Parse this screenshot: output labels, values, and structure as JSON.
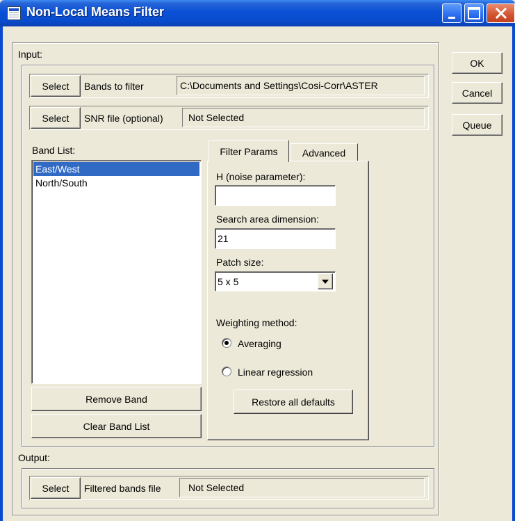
{
  "window": {
    "title": "Non-Local Means Filter"
  },
  "input": {
    "group_label": "Input:",
    "bands": {
      "button": "Select",
      "label": "Bands to filter",
      "value": "C:\\Documents and Settings\\Cosi-Corr\\ASTER"
    },
    "snr": {
      "button": "Select",
      "label": "SNR file (optional)",
      "value": "Not Selected"
    },
    "band_list": {
      "label": "Band List:",
      "items": [
        "East/West",
        "North/South"
      ],
      "selected_index": 0
    },
    "remove_band": "Remove Band",
    "clear_band_list": "Clear Band List"
  },
  "tabs": {
    "items": [
      "Filter Params",
      "Advanced"
    ],
    "active_index": 0
  },
  "filter_params": {
    "h_label": "H (noise parameter):",
    "h_value": "",
    "search_label": "Search area dimension:",
    "search_value": "21",
    "patch_label": "Patch size:",
    "patch_value": "5 x 5",
    "weighting_label": "Weighting method:",
    "weighting_options": [
      "Averaging",
      "Linear regression"
    ],
    "weighting_selected": "Averaging",
    "restore_defaults": "Restore all defaults"
  },
  "output": {
    "group_label": "Output:",
    "button": "Select",
    "label": "Filtered bands file",
    "value": "Not Selected"
  },
  "side_buttons": {
    "ok": "OK",
    "cancel": "Cancel",
    "queue": "Queue"
  },
  "icons": [
    "app-icon",
    "minimize-icon",
    "maximize-icon",
    "close-icon",
    "dropdown-arrow-icon"
  ]
}
